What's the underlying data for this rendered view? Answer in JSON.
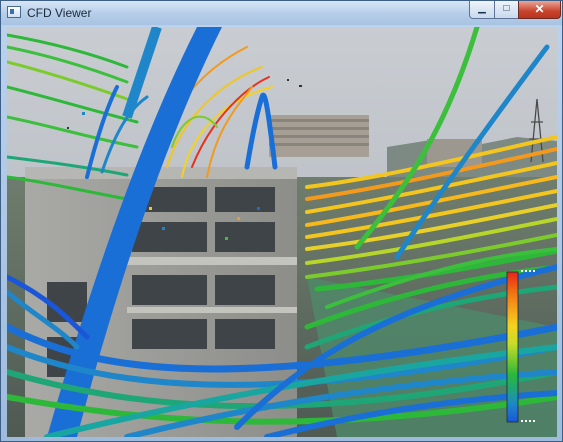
{
  "window": {
    "title": "CFD Viewer",
    "controls": {
      "minimize": "▁",
      "maximize": "□",
      "close": "✕"
    }
  },
  "viewport": {
    "content": "AR overlay of CFD wind streamlines over a photographed school building",
    "scene_icons": [
      "building",
      "sky",
      "apartment-blocks",
      "power-tower",
      "hills",
      "sports-court"
    ]
  },
  "legend": {
    "colors_top_to_bottom": [
      "#e8241a",
      "#f06a12",
      "#f5a51a",
      "#f4d21f",
      "#c6dc28",
      "#7ccb2d",
      "#2eb83a",
      "#1fa677",
      "#1e86c9",
      "#1a56d9"
    ]
  },
  "colors": {
    "streamline_blue": "#1a6fd6",
    "streamline_teal": "#1aa6a0",
    "streamline_green": "#3cbf3c",
    "streamline_yellow": "#f3c51f",
    "streamline_orange": "#f39a1c",
    "streamline_red": "#e8301a"
  }
}
